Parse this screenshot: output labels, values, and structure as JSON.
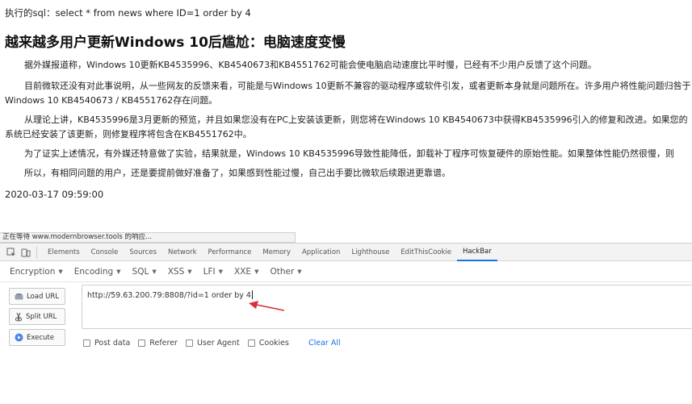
{
  "page": {
    "sql_line": "执行的sql：select * from news where ID=1 order by 4",
    "title": "越来越多用户更新Windows 10后尴尬：电脑速度变慢",
    "paragraphs": [
      "据外媒报道称，Windows 10更新KB4535996、KB4540673和KB4551762可能会使电脑启动速度比平时慢，已经有不少用户反馈了这个问题。",
      "目前微软还没有对此事说明，从一些网友的反馈来看，可能是与Windows 10更新不兼容的驱动程序或软件引发，或者更新本身就是问题所在。许多用户将性能问题归咎于Windows 10 KB4540673 / KB4551762存在问题。",
      "从理论上讲，KB4535996是3月更新的预览，并且如果您没有在PC上安装该更新，则您将在Windows 10 KB4540673中获得KB4535996引入的修复和改进。如果您的系统已经安装了该更新，则修复程序将包含在KB4551762中。",
      "为了证实上述情况，有外媒还特意做了实验，结果就是，Windows 10 KB4535996导致性能降低，卸载补丁程序可恢复硬件的原始性能。如果整体性能仍然很慢，则",
      "所以，有相同问题的用户，还是要提前做好准备了，如果感到性能过慢，自己出手要比微软后续跟进更靠谱。"
    ],
    "date": "2020-03-17 09:59:00"
  },
  "status_bar": "正在等待 www.modernbrowser.tools 的响应...",
  "devtools": {
    "tabs": [
      "Elements",
      "Console",
      "Sources",
      "Network",
      "Performance",
      "Memory",
      "Application",
      "Lighthouse",
      "EditThisCookie",
      "HackBar"
    ],
    "active_tab": "HackBar",
    "icons": [
      "inspect-icon",
      "device-toolbar-icon"
    ]
  },
  "hackbar": {
    "menus": [
      "Encryption",
      "Encoding",
      "SQL",
      "XSS",
      "LFI",
      "XXE",
      "Other"
    ],
    "buttons": {
      "load_url": "Load URL",
      "split_url": "Split URL",
      "execute": "Execute"
    },
    "url": "http://59.63.200.79:8808/?id=1 order by 4",
    "options": [
      "Post data",
      "Referer",
      "User Agent",
      "Cookies"
    ],
    "clear_all": "Clear All"
  },
  "colors": {
    "accent": "#1a73e8",
    "annotation_arrow": "#d9313a"
  }
}
